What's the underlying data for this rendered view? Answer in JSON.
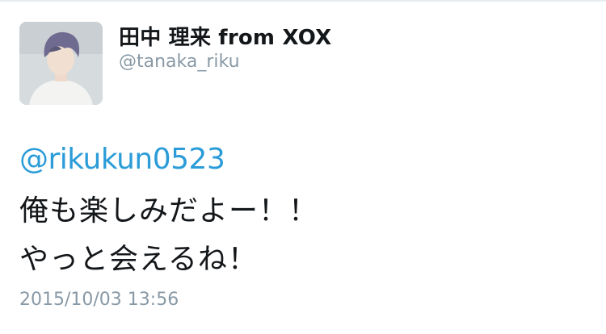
{
  "tweet": {
    "author": {
      "display_name": "田中 理来 from XOX",
      "handle": "@tanaka_riku",
      "avatar_icon": "profile-photo-avatar"
    },
    "mention": "@rikukun0523",
    "text_lines": [
      "俺も楽しみだよー！！",
      "やっと会えるね！"
    ],
    "timestamp": "2015/10/03 13:56"
  },
  "colors": {
    "mention_link": "#2b9cd8",
    "secondary_text": "#8899a6",
    "primary_text": "#14171a"
  }
}
